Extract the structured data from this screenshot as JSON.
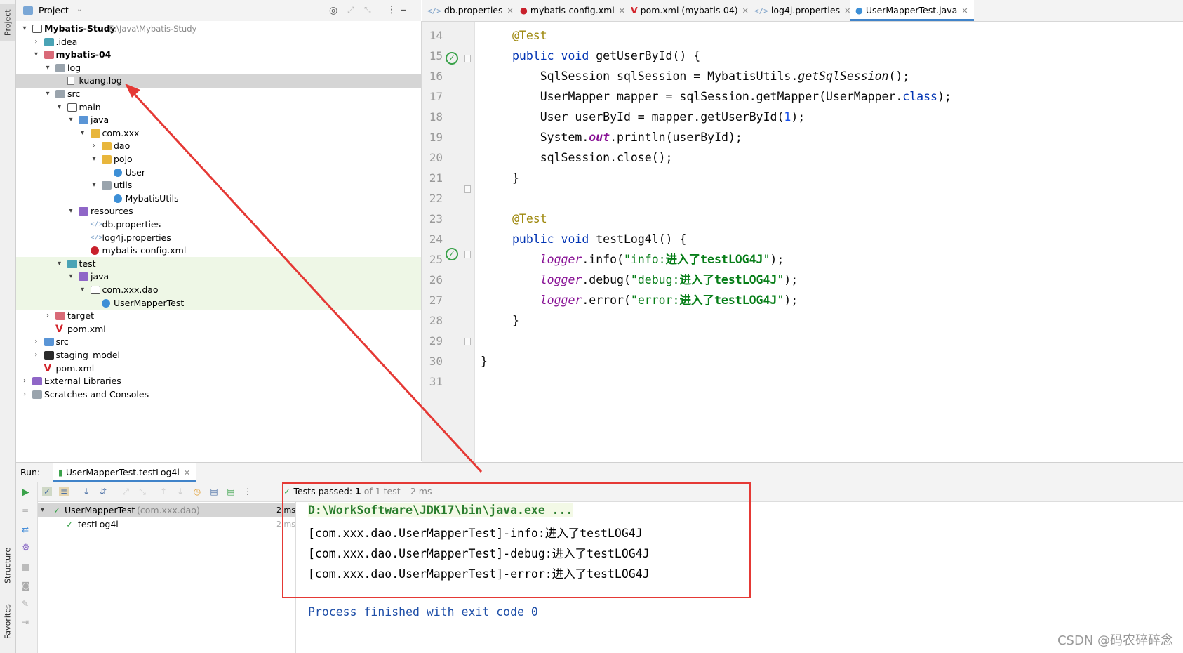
{
  "left_strip": {
    "project_tab": "Project",
    "structure_tab": "Structure",
    "favorites_tab": "Favorites"
  },
  "project_panel": {
    "title": "Project",
    "tree": [
      {
        "label": "Mybatis-Study",
        "extra": "E:\\Java\\Mybatis-Study",
        "icon": "folder-outline-icon"
      },
      {
        "label": ".idea",
        "icon": "folder-teal-icon"
      },
      {
        "label": "mybatis-04",
        "icon": "module-folder-icon"
      },
      {
        "label": "log",
        "icon": "folder-gray-icon"
      },
      {
        "label": "kuang.log",
        "icon": "log-file-icon"
      },
      {
        "label": "src",
        "icon": "folder-gray-icon"
      },
      {
        "label": "main",
        "icon": "folder-outline-icon"
      },
      {
        "label": "java",
        "icon": "source-root-icon"
      },
      {
        "label": "com.xxx",
        "icon": "package-icon"
      },
      {
        "label": "dao",
        "icon": "package-icon"
      },
      {
        "label": "pojo",
        "icon": "package-icon"
      },
      {
        "label": "User",
        "icon": "class-icon"
      },
      {
        "label": "utils",
        "icon": "package-icon"
      },
      {
        "label": "MybatisUtils",
        "icon": "class-icon"
      },
      {
        "label": "resources",
        "icon": "resources-root-icon"
      },
      {
        "label": "db.properties",
        "icon": "properties-file-icon"
      },
      {
        "label": "log4j.properties",
        "icon": "properties-file-icon"
      },
      {
        "label": "mybatis-config.xml",
        "icon": "mybatis-xml-icon"
      },
      {
        "label": "test",
        "icon": "test-folder-icon"
      },
      {
        "label": "java",
        "icon": "test-source-root-icon"
      },
      {
        "label": "com.xxx.dao",
        "icon": "package-outline-icon"
      },
      {
        "label": "UserMapperTest",
        "icon": "class-icon"
      },
      {
        "label": "target",
        "icon": "excluded-folder-icon"
      },
      {
        "label": "pom.xml",
        "icon": "maven-icon"
      },
      {
        "label": "src",
        "icon": "folder-blue-icon"
      },
      {
        "label": "staging_model",
        "icon": "folder-black-icon"
      },
      {
        "label": "pom.xml",
        "icon": "maven-icon"
      },
      {
        "label": "External Libraries",
        "icon": "library-icon"
      },
      {
        "label": "Scratches and Consoles",
        "icon": "scratches-icon"
      }
    ]
  },
  "editor": {
    "tabs": [
      {
        "label": "db.properties"
      },
      {
        "label": "mybatis-config.xml"
      },
      {
        "label": "pom.xml (mybatis-04)"
      },
      {
        "label": "log4j.properties"
      },
      {
        "label": "UserMapperTest.java"
      }
    ],
    "line_numbers": [
      "14",
      "15",
      "16",
      "17",
      "18",
      "19",
      "20",
      "21",
      "22",
      "23",
      "24",
      "25",
      "26",
      "27",
      "28",
      "29",
      "30",
      "31"
    ]
  },
  "run_panel": {
    "label": "Run:",
    "tab": "UserMapperTest.testLog4l",
    "test_tree": [
      {
        "name": "UserMapperTest",
        "pkg": "(com.xxx.dao)",
        "time": "2 ms"
      },
      {
        "name": "testLog4l",
        "pkg": "",
        "time": "2 ms"
      }
    ],
    "status_prefix": "Tests passed:",
    "status_count": "1",
    "status_rest": "of 1 test – 2 ms",
    "console": {
      "command": "D:\\WorkSoftware\\JDK17\\bin\\java.exe ...",
      "lines": [
        "[com.xxx.dao.UserMapperTest]-info:进入了testLOG4J",
        "[com.xxx.dao.UserMapperTest]-debug:进入了testLOG4J",
        "[com.xxx.dao.UserMapperTest]-error:进入了testLOG4J"
      ],
      "finish": "Process finished with exit code 0"
    }
  },
  "watermark": "CSDN @码农碎碎念",
  "colors": {
    "accent": "#4083c9",
    "annotation_red": "#e53935",
    "pass_green": "#3aa24a"
  }
}
